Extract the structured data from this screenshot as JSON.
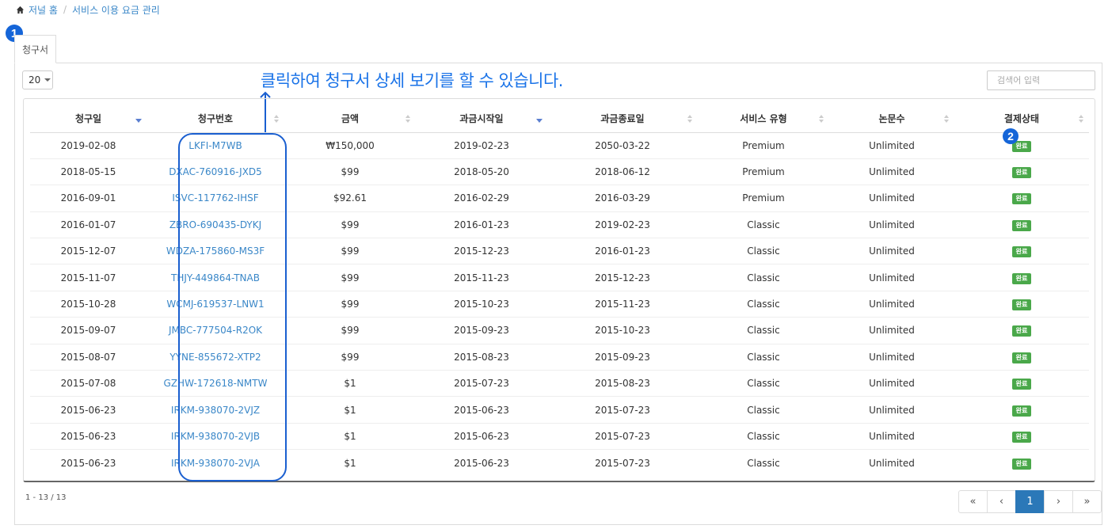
{
  "breadcrumb": {
    "home": "저널 홈",
    "separator": "/",
    "current": "서비스 이용 요금 관리"
  },
  "markers": {
    "first": "1",
    "second": "2"
  },
  "tab": {
    "label": "청구서"
  },
  "controls": {
    "page_size": "20",
    "search_placeholder": "검색어 입력"
  },
  "callout": {
    "text": "클릭하여 청구서 상세 보기를 할 수 있습니다."
  },
  "table": {
    "headers": [
      "청구일",
      "청구번호",
      "금액",
      "과금시작일",
      "과금종료일",
      "서비스 유형",
      "논문수",
      "결제상태"
    ],
    "rows": [
      [
        "2019-02-08",
        "LKFI-M7WB",
        "₩150,000",
        "2019-02-23",
        "2050-03-22",
        "Premium",
        "Unlimited",
        "완료"
      ],
      [
        "2018-05-15",
        "DXAC-760916-JXD5",
        "$99",
        "2018-05-20",
        "2018-06-12",
        "Premium",
        "Unlimited",
        "완료"
      ],
      [
        "2016-09-01",
        "ISVC-117762-IHSF",
        "$92.61",
        "2016-02-29",
        "2016-03-29",
        "Premium",
        "Unlimited",
        "완료"
      ],
      [
        "2016-01-07",
        "ZBRO-690435-DYKJ",
        "$99",
        "2016-01-23",
        "2019-02-23",
        "Classic",
        "Unlimited",
        "완료"
      ],
      [
        "2015-12-07",
        "WDZA-175860-MS3F",
        "$99",
        "2015-12-23",
        "2016-01-23",
        "Classic",
        "Unlimited",
        "완료"
      ],
      [
        "2015-11-07",
        "THJY-449864-TNAB",
        "$99",
        "2015-11-23",
        "2015-12-23",
        "Classic",
        "Unlimited",
        "완료"
      ],
      [
        "2015-10-28",
        "WCMJ-619537-LNW1",
        "$99",
        "2015-10-23",
        "2015-11-23",
        "Classic",
        "Unlimited",
        "완료"
      ],
      [
        "2015-09-07",
        "JMBC-777504-R2OK",
        "$99",
        "2015-09-23",
        "2015-10-23",
        "Classic",
        "Unlimited",
        "완료"
      ],
      [
        "2015-08-07",
        "YYNE-855672-XTP2",
        "$99",
        "2015-08-23",
        "2015-09-23",
        "Classic",
        "Unlimited",
        "완료"
      ],
      [
        "2015-07-08",
        "GZHW-172618-NMTW",
        "$1",
        "2015-07-23",
        "2015-08-23",
        "Classic",
        "Unlimited",
        "완료"
      ],
      [
        "2015-06-23",
        "IRKM-938070-2VJZ",
        "$1",
        "2015-06-23",
        "2015-07-23",
        "Classic",
        "Unlimited",
        "완료"
      ],
      [
        "2015-06-23",
        "IRKM-938070-2VJB",
        "$1",
        "2015-06-23",
        "2015-07-23",
        "Classic",
        "Unlimited",
        "완료"
      ],
      [
        "2015-06-23",
        "IRKM-938070-2VJA",
        "$1",
        "2015-06-23",
        "2015-07-23",
        "Classic",
        "Unlimited",
        "완료"
      ]
    ]
  },
  "footer": {
    "count": "1 - 13 / 13"
  },
  "pagination": {
    "first": "«",
    "prev": "‹",
    "current": "1",
    "next": "›",
    "last": "»"
  },
  "colors": {
    "accent": "#1a73e8",
    "link": "#3a87c8",
    "status_done": "#4aa84a",
    "active_page": "#2b78b8"
  }
}
